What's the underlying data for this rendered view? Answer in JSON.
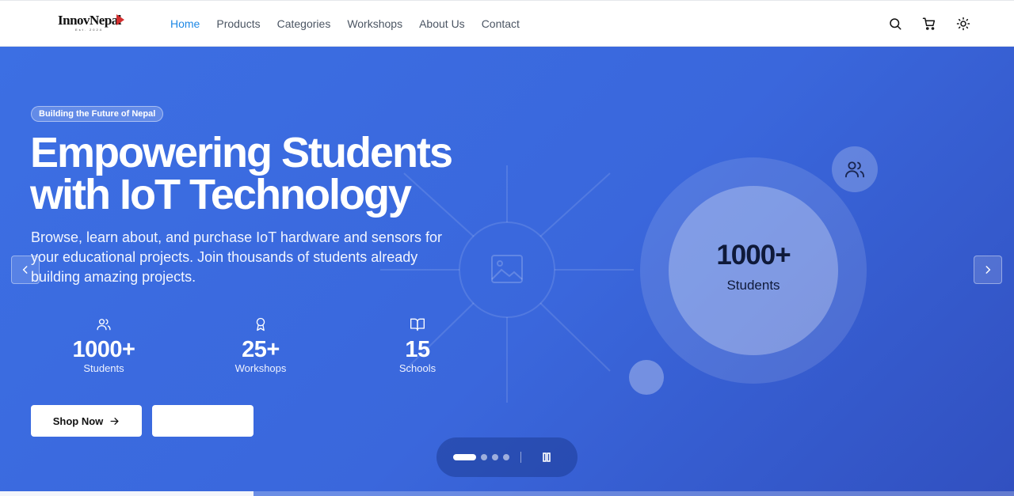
{
  "brand": {
    "name": "InnovNepal",
    "tagline": "Est. 2024"
  },
  "nav": {
    "items": [
      {
        "label": "Home",
        "active": true
      },
      {
        "label": "Products"
      },
      {
        "label": "Categories"
      },
      {
        "label": "Workshops"
      },
      {
        "label": "About Us"
      },
      {
        "label": "Contact"
      }
    ]
  },
  "header_icons": [
    "search-icon",
    "cart-icon",
    "theme-toggle-icon"
  ],
  "hero": {
    "badge": "Building the Future of Nepal",
    "headline_line1": "Empowering Students",
    "headline_line2": "with IoT Technology",
    "description": "Browse, learn about, and purchase IoT hardware and sensors for your educational projects. Join thousands of students already building amazing projects.",
    "stats": [
      {
        "icon": "users-icon",
        "value": "1000+",
        "label": "Students"
      },
      {
        "icon": "award-icon",
        "value": "25+",
        "label": "Workshops"
      },
      {
        "icon": "book-icon",
        "value": "15",
        "label": "Schools"
      }
    ],
    "primary_button": "Shop Now",
    "secondary_button": "",
    "feature_circle": {
      "value": "1000+",
      "label": "Students"
    }
  },
  "carousel": {
    "slides": 4,
    "active_slide": 1,
    "progress": 0.25
  },
  "colors": {
    "accent": "#1e88e5",
    "hero_start": "#3c6fe3",
    "hero_end": "#3150c0"
  }
}
